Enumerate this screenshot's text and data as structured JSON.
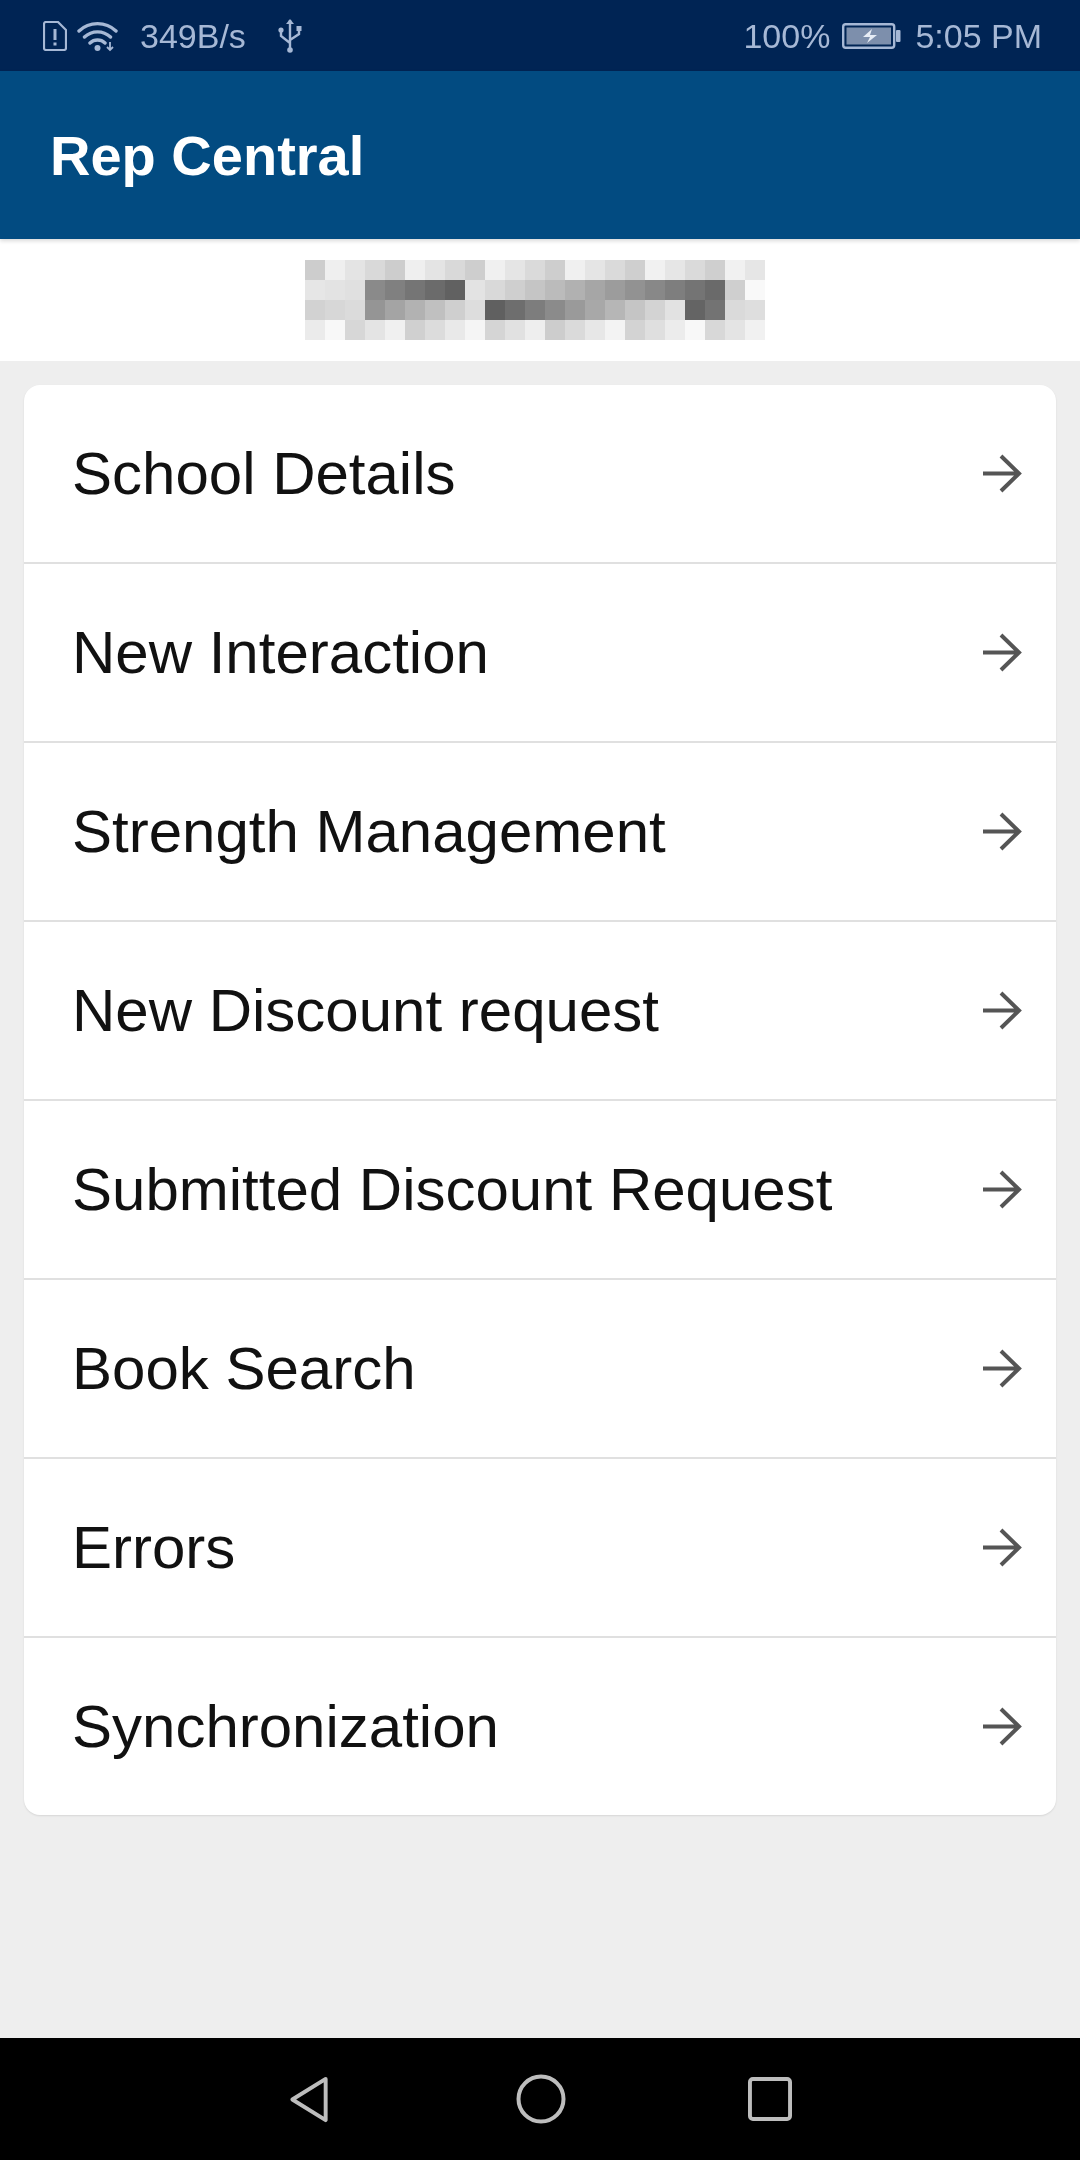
{
  "status_bar": {
    "network_speed": "349B/s",
    "battery_percent": "100%",
    "time": "5:05 PM"
  },
  "app_bar": {
    "title": "Rep Central"
  },
  "user_banner": {
    "name_obscured": true
  },
  "menu": {
    "items": [
      {
        "label": "School Details"
      },
      {
        "label": "New Interaction"
      },
      {
        "label": "Strength Management"
      },
      {
        "label": "New Discount request"
      },
      {
        "label": "Submitted Discount Request"
      },
      {
        "label": "Book Search"
      },
      {
        "label": "Errors"
      },
      {
        "label": "Synchronization"
      }
    ]
  }
}
